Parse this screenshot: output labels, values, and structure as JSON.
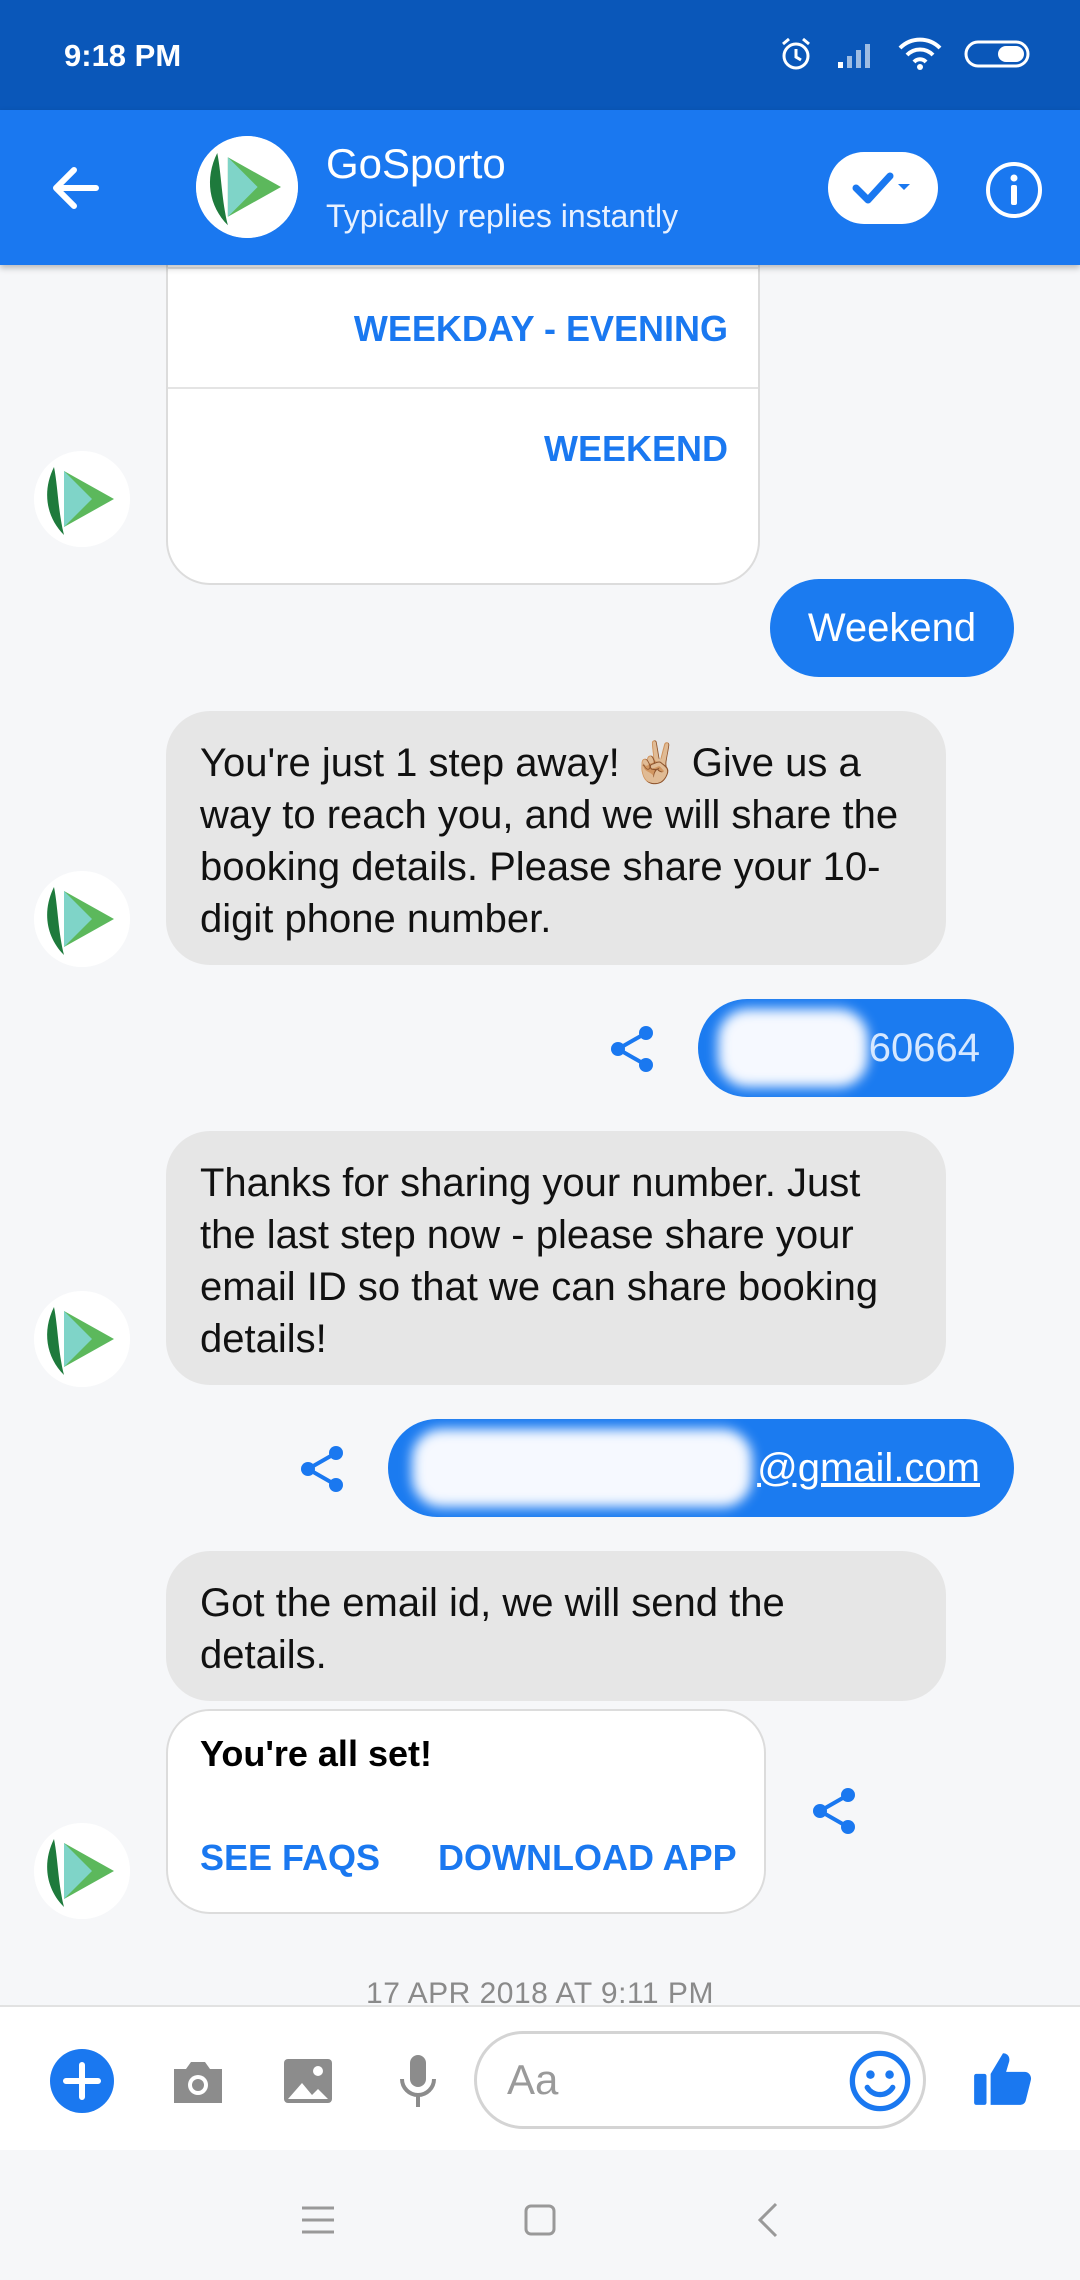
{
  "status_bar": {
    "time": "9:18 PM"
  },
  "header": {
    "title": "GoSporto",
    "subtitle": "Typically replies instantly"
  },
  "quick_replies": [
    "WEEKDAY - EVENING",
    "WEEKEND"
  ],
  "messages": {
    "user_weekend": "Weekend",
    "bot_phone_request": "You're just 1 step away! ✌🏼 Give us a way to reach you, and we will share the booking details. Please share your 10-digit phone number.",
    "user_phone_visible": "60664",
    "bot_email_request": "Thanks for sharing your number. Just the last step now - please share your email ID so that we can share booking details!",
    "user_email_visible": "@gmail.com",
    "bot_email_ack": "Got the email id, we will send the details."
  },
  "card": {
    "title": "You're all set!",
    "buttons": [
      "SEE FAQS",
      "DOWNLOAD APP"
    ]
  },
  "timestamp": "17 APR 2018 AT 9:11 PM",
  "composer": {
    "placeholder": "Aa"
  },
  "colors": {
    "header": "#1a78f0",
    "status_bar": "#0a57b9",
    "bubble_out": "#1b7bf0",
    "bubble_in": "#e6e6e6",
    "logo_green": "#5cb85c",
    "logo_dark": "#1e7a3c"
  }
}
